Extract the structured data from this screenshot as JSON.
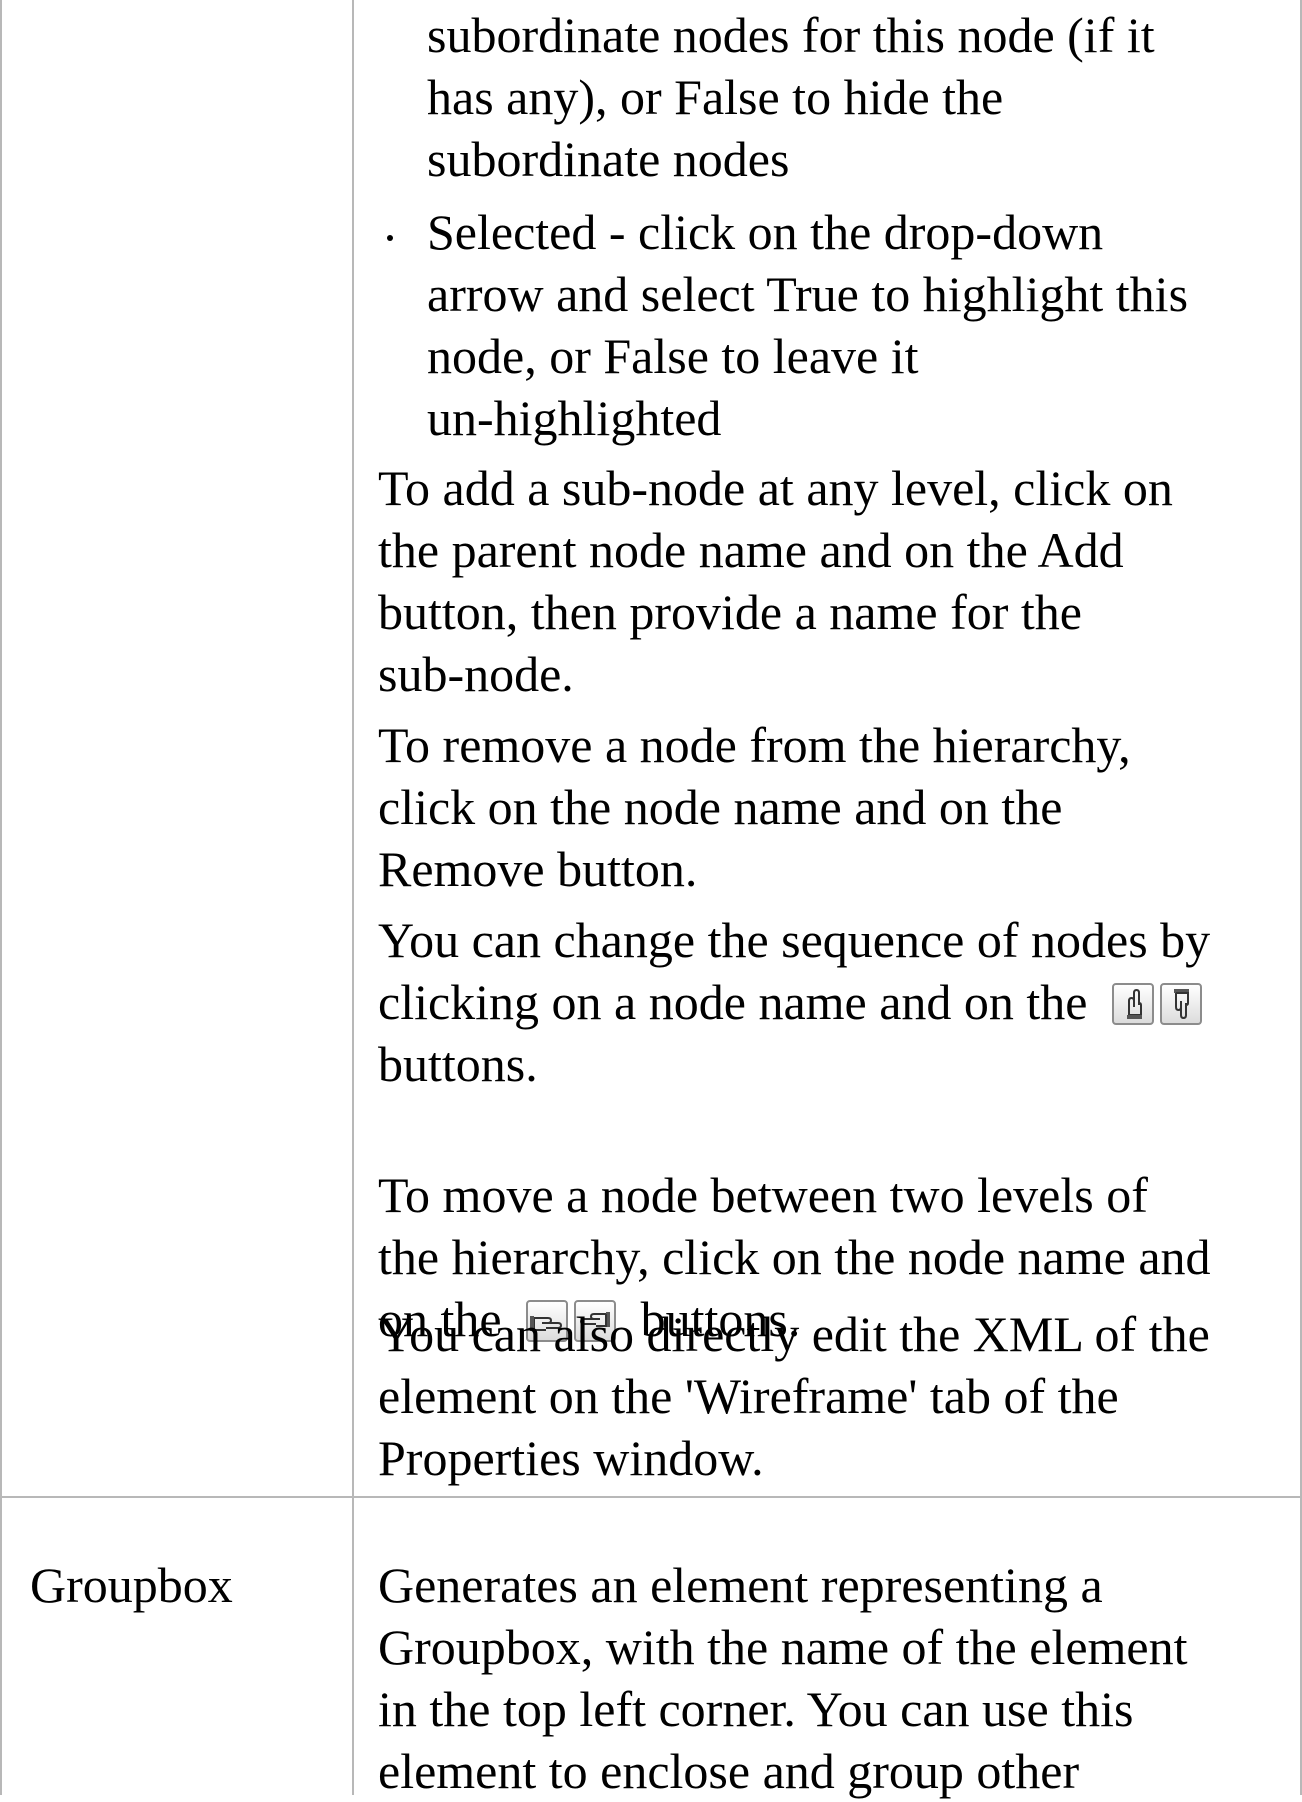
{
  "table": {
    "row1": {
      "bullets": [
        {
          "lines": [
            "subordinate nodes for this node (if it",
            "has any), or False to hide the",
            "subordinate nodes"
          ],
          "continued": true
        },
        {
          "lines": [
            "Selected - click on the drop-down",
            "arrow and select True to highlight this",
            "node, or False to leave it",
            "un-highlighted"
          ],
          "continued": false
        }
      ],
      "para_add": [
        "To add a sub-node at any level, click on",
        "the parent node name and on the Add",
        "button, then provide a name for the",
        "sub-node."
      ],
      "para_remove": [
        "To remove a node from the hierarchy,",
        "click on the node name and on the",
        "Remove button."
      ],
      "para_sequence": {
        "line1": "You can change the sequence of nodes by",
        "line2": "clicking on a node name and on the",
        "line3": "buttons.",
        "icons": [
          "move-up-hand-icon",
          "move-down-hand-icon"
        ]
      },
      "para_move": {
        "line1": "To move a node between two levels of",
        "line2": "the hierarchy, click on the node name and",
        "line3_prefix": "on the",
        "line3_suffix": "buttons.",
        "icons": [
          "move-left-hand-icon",
          "move-right-hand-icon"
        ]
      },
      "para_xml": [
        "You can also directly edit the XML of the",
        "element on the 'Wireframe' tab of the",
        "Properties window."
      ]
    },
    "row2": {
      "name": "Groupbox",
      "description": [
        "Generates an element representing a",
        "Groupbox, with the name of the element",
        "in the top left corner. You can use this",
        "element to enclose and group other"
      ]
    }
  }
}
